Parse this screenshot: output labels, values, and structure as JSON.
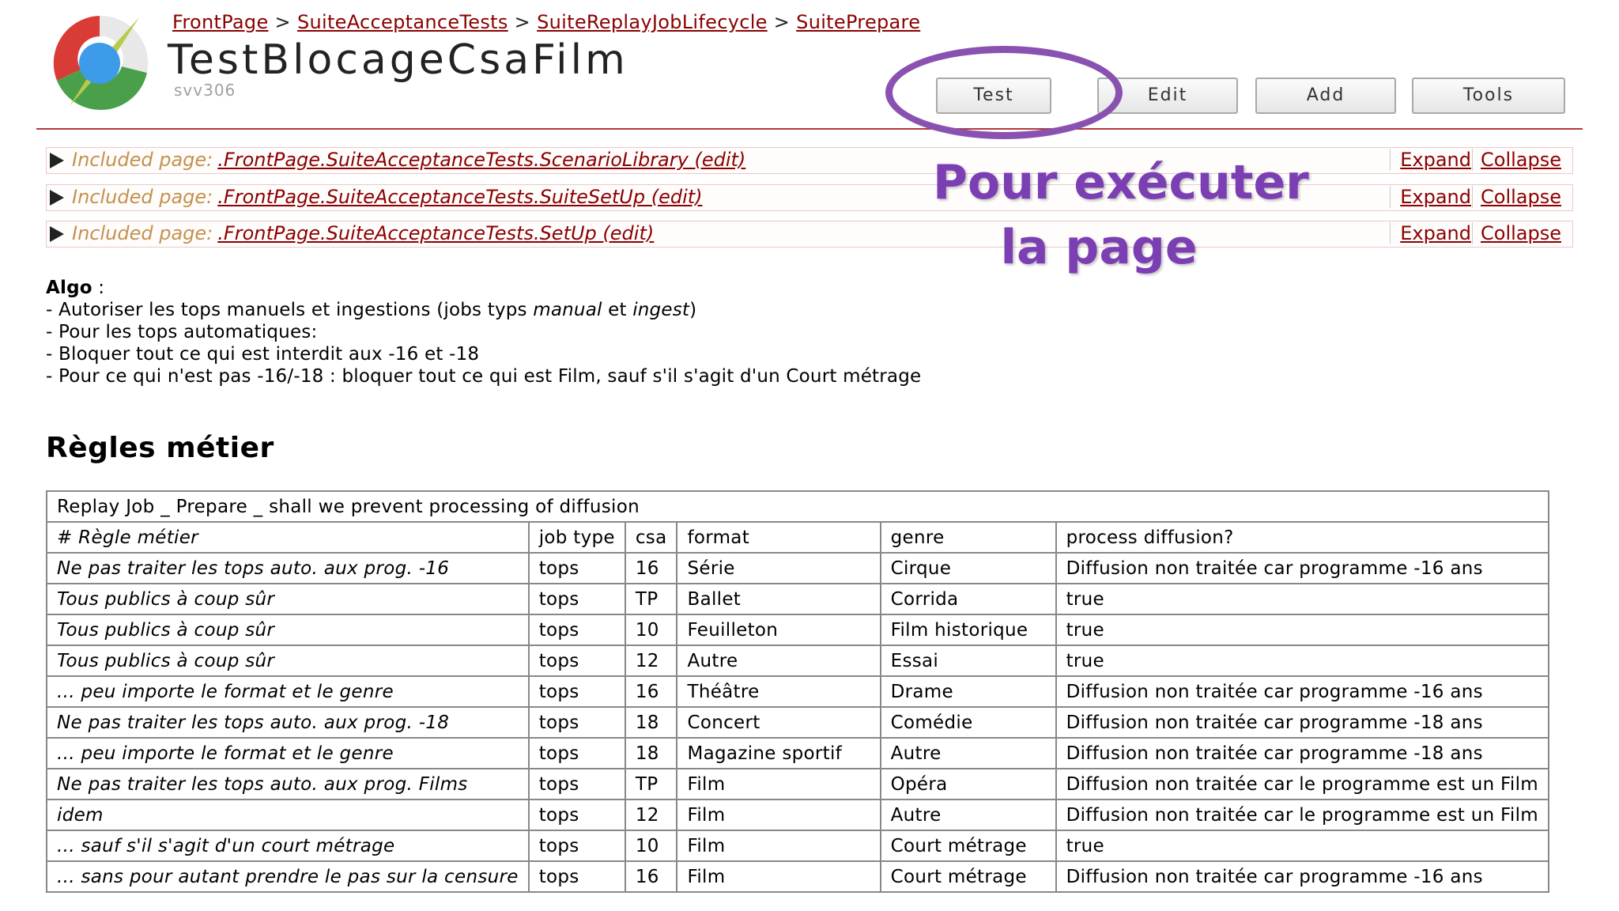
{
  "breadcrumb": [
    "FrontPage",
    "SuiteAcceptanceTests",
    "SuiteReplayJobLifecycle",
    "SuitePrepare"
  ],
  "breadcrumb_separator": ">",
  "page_title": "TestBlocageCsaFilm",
  "page_subtitle": "svv306",
  "toolbar": {
    "test": "Test",
    "edit": "Edit",
    "add": "Add",
    "tools": "Tools"
  },
  "included_prefix": "Included page:",
  "included_pages": [
    {
      "path": ".FrontPage.SuiteAcceptanceTests.ScenarioLibrary (edit)"
    },
    {
      "path": ".FrontPage.SuiteAcceptanceTests.SuiteSetUp (edit)"
    },
    {
      "path": ".FrontPage.SuiteAcceptanceTests.SetUp (edit)"
    }
  ],
  "expand_label": "Expand",
  "collapse_label": "Collapse",
  "algo": {
    "heading": "Algo",
    "heading_suffix": " :",
    "line1_a": "- Autoriser les tops manuels et ingestions (jobs typs ",
    "line1_manual": "manual",
    "line1_b": " et ",
    "line1_ingest": "ingest",
    "line1_c": ")",
    "line2": "- Pour les tops automatiques:",
    "line3": "- Bloquer tout ce qui est interdit aux -16 et -18",
    "line4": "- Pour ce qui n'est pas -16/-18 : bloquer tout ce qui est Film, sauf s'il s'agit d'un Court métrage"
  },
  "section_heading": "Règles métier",
  "table": {
    "caption": "Replay Job _ Prepare _ shall we prevent processing of diffusion",
    "headers": [
      "# Règle métier",
      "job type",
      "csa",
      "format",
      "genre",
      "process diffusion?"
    ],
    "rows": [
      [
        "Ne pas traiter les tops auto. aux prog. -16",
        "tops",
        "16",
        "Série",
        "Cirque",
        "Diffusion non traitée car programme -16 ans"
      ],
      [
        "Tous publics à coup sûr",
        "tops",
        "TP",
        "Ballet",
        "Corrida",
        "true"
      ],
      [
        "Tous publics à coup sûr",
        "tops",
        "10",
        "Feuilleton",
        "Film historique",
        "true"
      ],
      [
        "Tous publics à coup sûr",
        "tops",
        "12",
        "Autre",
        "Essai",
        "true"
      ],
      [
        "... peu importe le format et le genre",
        "tops",
        "16",
        "Théâtre",
        "Drame",
        "Diffusion non traitée car programme -16 ans"
      ],
      [
        "Ne pas traiter les tops auto. aux prog. -18",
        "tops",
        "18",
        "Concert",
        "Comédie",
        "Diffusion non traitée car programme -18 ans"
      ],
      [
        "... peu importe le format et le genre",
        "tops",
        "18",
        "Magazine sportif",
        "Autre",
        "Diffusion non traitée car programme -18 ans"
      ],
      [
        "Ne pas traiter les tops auto. aux prog. Films",
        "tops",
        "TP",
        "Film",
        "Opéra",
        "Diffusion non traitée car le programme est un Film"
      ],
      [
        "idem",
        "tops",
        "12",
        "Film",
        "Autre",
        "Diffusion non traitée car le programme est un Film"
      ],
      [
        "... sauf s'il s'agit d'un court métrage",
        "tops",
        "10",
        "Film",
        "Court métrage",
        "true"
      ],
      [
        "... sans pour autant prendre le pas sur la censure",
        "tops",
        "16",
        "Film",
        "Court métrage",
        "Diffusion non traitée car programme -16 ans"
      ]
    ]
  },
  "annotation": {
    "line1": "Pour exécuter",
    "line2": "la page",
    "color": "#7b3fb3"
  },
  "colors": {
    "link": "#8b0000",
    "included_label": "#c4914d",
    "rule": "#b33a3a"
  }
}
